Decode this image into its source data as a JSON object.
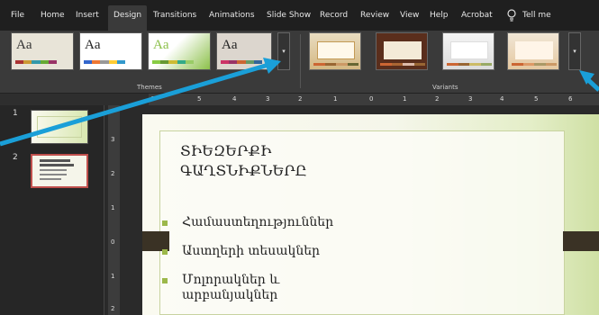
{
  "menu": {
    "tabs": [
      {
        "label": "File"
      },
      {
        "label": "Home"
      },
      {
        "label": "Insert"
      },
      {
        "label": "Design"
      },
      {
        "label": "Transitions"
      },
      {
        "label": "Animations"
      },
      {
        "label": "Slide Show"
      },
      {
        "label": "Record"
      },
      {
        "label": "Review"
      },
      {
        "label": "View"
      },
      {
        "label": "Help"
      },
      {
        "label": "Acrobat"
      },
      {
        "label": "Tell me"
      }
    ],
    "active_tab": "Design",
    "tell_icon": "lightbulb-icon"
  },
  "ribbon": {
    "themes": {
      "label": "Themes",
      "items": [
        {
          "aa": "Aa",
          "bg": "#e8e4d8",
          "fg": "#333333"
        },
        {
          "aa": "Aa",
          "bg": "#ffffff",
          "fg": "#222222"
        },
        {
          "aa": "Aa",
          "bg": "#8cc04a",
          "fg": "#ffffff"
        },
        {
          "aa": "Aa",
          "bg": "#dcd6ce",
          "fg": "#222222"
        }
      ],
      "more_icon": "chevron-down-icon"
    },
    "variants": {
      "label": "Variants",
      "more_icon": "chevron-down-icon"
    }
  },
  "ruler": {
    "numbers": [
      "6",
      "5",
      "4",
      "3",
      "2",
      "1",
      "0",
      "1",
      "2",
      "3",
      "4",
      "5",
      "6"
    ]
  },
  "vruler": {
    "numbers": [
      "3",
      "2",
      "1",
      "0",
      "1",
      "2"
    ]
  },
  "slides": [
    {
      "number": "1"
    },
    {
      "number": "2"
    }
  ],
  "slide": {
    "title": "ՏԻԵԶԵՐՔԻ\nԳԱՂՏՆԻՔՆԵՐԸ",
    "bullets": [
      "Համաստեղություններ",
      "Աստղերի տեսակներ",
      "Մոլորակներ և",
      "արբանյակներ"
    ]
  },
  "colors": {
    "accent": "#1a9fd8",
    "ribbon_bg": "#3a3a3a",
    "slide_green": "#9cb84a"
  }
}
